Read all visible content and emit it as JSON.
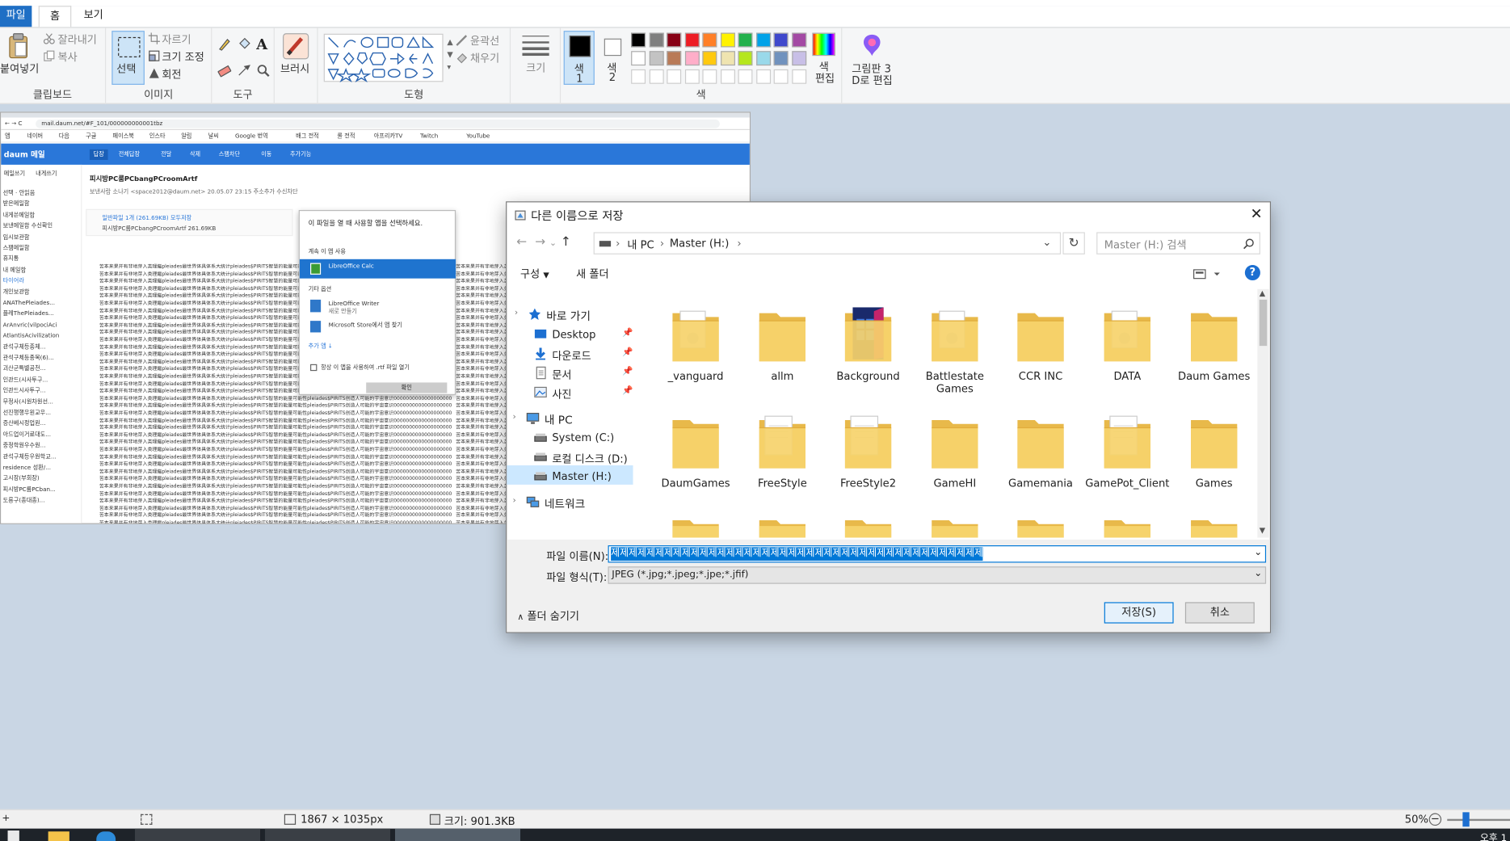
{
  "ribbon": {
    "tabs": [
      "파일",
      "홈",
      "보기"
    ],
    "clipboard": {
      "paste": "붙여넣기",
      "cut": "잘라내기",
      "copy": "복사",
      "label": "클립보드"
    },
    "image": {
      "select": "선택",
      "crop": "자르기",
      "resize": "크기 조정",
      "rotate": "회전",
      "label": "이미지"
    },
    "tools": {
      "label": "도구"
    },
    "brushes": {
      "label": "브러시"
    },
    "shapes": {
      "outline": "윤곽선",
      "fill": "채우기",
      "label": "도형"
    },
    "size": {
      "label": "크기"
    },
    "colors": {
      "color1": "색",
      "color1_num": "1",
      "color2": "색",
      "color2_num": "2",
      "edit": "색",
      "edit2": "편집",
      "label": "색",
      "primary": "#000000",
      "secondary": "#ffffff",
      "palette_row1": [
        "#000000",
        "#7f7f7f",
        "#880015",
        "#ed1c24",
        "#ff7f27",
        "#fff200",
        "#22b14c",
        "#00a2e8",
        "#3f48cc",
        "#a349a4"
      ],
      "palette_row2": [
        "#ffffff",
        "#c3c3c3",
        "#b97a57",
        "#ffaec9",
        "#ffc90e",
        "#efe4b0",
        "#b5e61d",
        "#99d9ea",
        "#7092be",
        "#c8bfe7"
      ]
    },
    "paint3d": {
      "line1": "그림판 3",
      "line2": "D로 편집"
    }
  },
  "image_content": {
    "url": "mail.daum.net/#F_101/000000000001tbz",
    "bookmarks": [
      "앱",
      "네이버",
      "다음",
      "구글",
      "페이스북",
      "인스타",
      "알림",
      "날씨",
      "Google 번역",
      "배그 전적",
      "롤 전적",
      "아프리카TV",
      "Twitch",
      "YouTube"
    ],
    "logo": "daum 메일",
    "topnav": [
      "답장",
      "전체답장",
      "전달",
      "삭제",
      "스팸차단",
      "이동",
      "추가기능"
    ],
    "subject": "피시방PC룸PCbangPCroomArtf",
    "sender": "보낸사람  소나기 <space2012@daum.net>  20.05.07 23:15  주소추가  수신차단",
    "attach_label": "일반파일 1개 (261.69KB)  모두저장",
    "attach_file": "피시방PC룸PCbangPCroomArtf  261.69KB",
    "left_top": [
      "메일쓰기",
      "내게쓰기"
    ],
    "left_items": [
      "선택 · 안읽음",
      "받은메일함",
      "내게쓴메일함",
      "보낸메일함  수신확인",
      "임시보관함",
      "스팸메일함",
      "휴지통",
      "내 메일함",
      "타이어라",
      "개인보관함",
      "ANAThePleiades...",
      "플레ThePleiades...",
      "ArAnvric(vilpociAci",
      "AtlantisAcivilization",
      "관석구체등종체...",
      "관석구체등종목(6)...",
      "괴산군특별공천...",
      "인관드(시사투구...",
      "인관드시사투구...",
      "무정사(시원차원선...",
      "선진행행우원교우...",
      "증산베시정업원...",
      "아드업이거료대도...",
      "중정학원우수원...",
      "관석구체등우원학교...",
      "residence 성환/...",
      "고시장(부회장)",
      "피시방PC룸PCban...",
      "도룡구(종대종)..."
    ],
    "body_line": "苦本来果并有非地芽入类理繼pleiades最世界体具体系大统计pleiades$PIRITS智慧的能量可能性pleiades$PIRITS创造人可能的宇宙意识0000000000000000000",
    "popup_title": "이 파일을 열 때 사용할 앱을 선택하세요.",
    "popup_keep": "계속 이 앱 사용",
    "popup_app1": "LibreOffice Calc",
    "popup_other": "기타 옵션",
    "popup_app2": "LibreOffice Writer",
    "popup_app2_sub": "새로 만들기",
    "popup_app3": "Microsoft Store에서 앱 찾기",
    "popup_more": "추가 앱 ↓",
    "popup_always": "항상 이 앱을 사용하여 .rtf 파일 열기",
    "popup_ok": "확인"
  },
  "dialog": {
    "title": "다른 이름으로 저장",
    "breadcrumb": [
      "내 PC",
      "Master (H:)"
    ],
    "search_placeholder": "Master (H:) 검색",
    "organize": "구성",
    "new_folder": "새 폴더",
    "nav": [
      {
        "label": "바로 가기",
        "icon": "star-icon"
      },
      {
        "label": "Desktop",
        "icon": "desktop-icon"
      },
      {
        "label": "다운로드",
        "icon": "download-icon"
      },
      {
        "label": "문서",
        "icon": "document-icon"
      },
      {
        "label": "사진",
        "icon": "picture-icon"
      },
      {
        "label": "내 PC",
        "icon": "computer-icon"
      },
      {
        "label": "System (C:)",
        "icon": "drive-icon"
      },
      {
        "label": "로컬 디스크 (D:)",
        "icon": "drive-icon"
      },
      {
        "label": "Master (H:)",
        "icon": "drive-icon"
      },
      {
        "label": "네트워크",
        "icon": "network-icon"
      }
    ],
    "folders_row1": [
      "_vanguard",
      "allm",
      "Background",
      "Battlestate Games",
      "CCR INC",
      "DATA",
      "Daum Games"
    ],
    "folders_row2": [
      "DaumGames",
      "FreeStyle",
      "FreeStyle2",
      "GameHI",
      "Gamemania",
      "GamePot_Client",
      "Games"
    ],
    "filename_label": "파일 이름(N):",
    "filename_value": "제제제제제제제제제제제제제제제제제제제제제제제제제제제제제제제제제제제제제제제제제제",
    "filetype_label": "파일 형식(T):",
    "filetype_value": "JPEG (*.jpg;*.jpeg;*.jpe;*.jfif)",
    "hide_folders": "폴더 숨기기",
    "save": "저장(S)",
    "cancel": "취소"
  },
  "status": {
    "dimensions": "1867 × 1035px",
    "size": "크기: 901.3KB",
    "zoom": "50%"
  },
  "taskbar": {
    "clock": "오후 1"
  }
}
